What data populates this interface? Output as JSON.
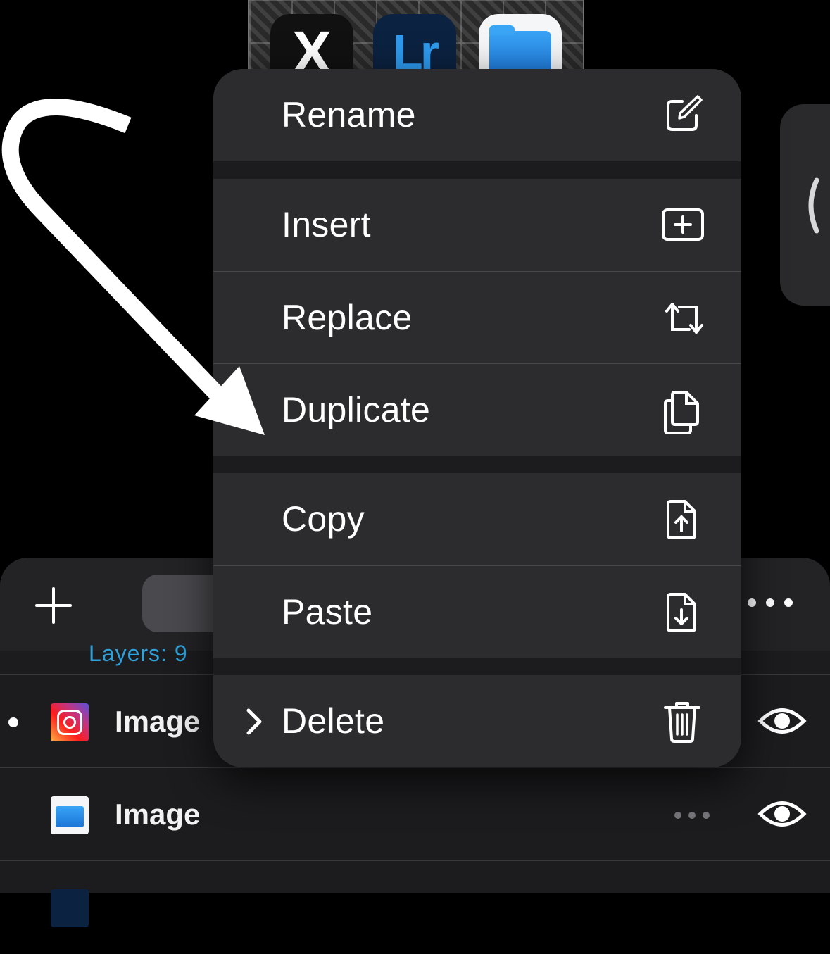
{
  "canvas": {
    "tiles": [
      {
        "name": "x-app-tile",
        "glyph": "X"
      },
      {
        "name": "lightroom-app-tile",
        "glyph": "Lr"
      },
      {
        "name": "files-app-tile",
        "glyph": ""
      }
    ]
  },
  "layers_panel": {
    "layers_count_label": "Layers: 9",
    "rows": [
      {
        "name": "Image",
        "thumbnail": "instagram-icon",
        "selected": true
      },
      {
        "name": "Image",
        "thumbnail": "files-icon",
        "selected": false
      },
      {
        "name": "",
        "thumbnail": "lightroom-icon",
        "selected": false
      }
    ]
  },
  "context_menu": {
    "items": [
      {
        "label": "Rename",
        "icon": "rename-icon"
      },
      {
        "label": "Insert",
        "icon": "insert-icon"
      },
      {
        "label": "Replace",
        "icon": "replace-icon"
      },
      {
        "label": "Duplicate",
        "icon": "duplicate-icon"
      },
      {
        "label": "Copy",
        "icon": "copy-icon"
      },
      {
        "label": "Paste",
        "icon": "paste-icon"
      },
      {
        "label": "Delete",
        "icon": "trash-icon",
        "has_submenu": true
      }
    ]
  },
  "colors": {
    "background": "#000000",
    "menu_item": "#2c2c2e",
    "panel": "#1c1c1e",
    "accent_text": "#2fa0d8"
  }
}
